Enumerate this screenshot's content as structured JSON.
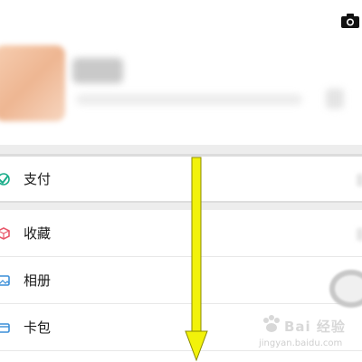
{
  "menu": {
    "pay": {
      "label": "支付",
      "icon": "pay-icon"
    },
    "favorites": {
      "label": "收藏",
      "icon": "favorites-cube-icon"
    },
    "album": {
      "label": "相册",
      "icon": "album-icon"
    },
    "cards": {
      "label": "卡包",
      "icon": "card-wallet-icon"
    }
  },
  "watermark": {
    "text": "Bai 经验",
    "url": "jingyan.baidu.com"
  },
  "colors": {
    "pay_icon": "#1aad8a",
    "favorites_icon": "#e8586b",
    "album_icon": "#3c8fd8",
    "cards_icon": "#3c8fd8",
    "annotation_arrow": "#f2f20a"
  }
}
